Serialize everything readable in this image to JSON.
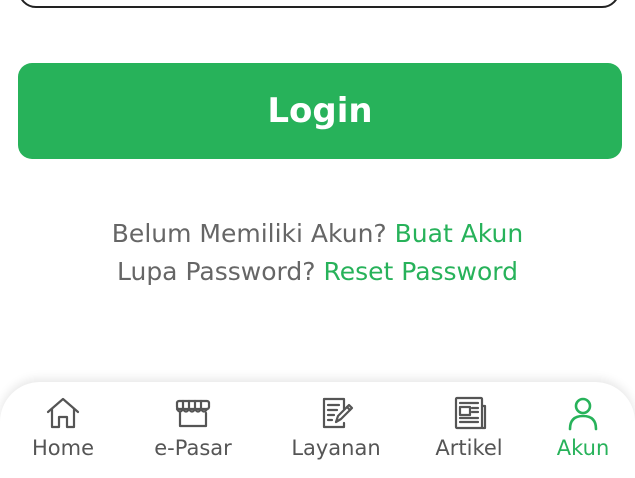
{
  "login": {
    "button_label": "Login"
  },
  "links": {
    "no_account_text": "Belum Memiliki Akun?",
    "create_account_link": "Buat Akun",
    "forgot_password_text": "Lupa Password?",
    "reset_password_link": "Reset Password"
  },
  "bottom_nav": {
    "items": [
      {
        "label": "Home",
        "icon": "home-icon"
      },
      {
        "label": "e-Pasar",
        "icon": "store-icon"
      },
      {
        "label": "Layanan",
        "icon": "document-edit-icon"
      },
      {
        "label": "Artikel",
        "icon": "newspaper-icon"
      },
      {
        "label": "Akun",
        "icon": "user-icon",
        "active": true
      }
    ]
  },
  "colors": {
    "accent": "#27b25a",
    "text_muted": "#666666",
    "nav_text": "#555555"
  }
}
